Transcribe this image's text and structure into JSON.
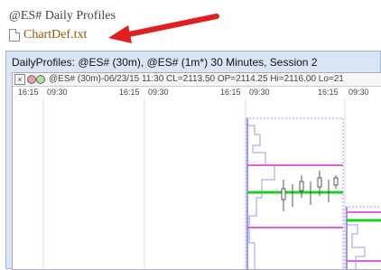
{
  "heading": "@ES# Daily Profiles",
  "file_link": "ChartDef.txt",
  "window": {
    "title": "DailyProfiles: @ES# (30m), @ES# (1m*) 30 Minutes, Session 2",
    "status": "@ES# (30m)-06/23/15 11:30 CL=2113.50 OP=2114.25 Hi=2116.00 Lo=21",
    "close": "×",
    "times": [
      "16:15",
      "09:30",
      "16:15",
      "09:30",
      "16:15",
      "09:30",
      "16:15",
      "09:30",
      "16:15",
      "09:30"
    ]
  },
  "colors": {
    "arrow": "#e02020",
    "poc": "#22cc22",
    "value": "#e060e0",
    "profile": "#9999ee"
  }
}
